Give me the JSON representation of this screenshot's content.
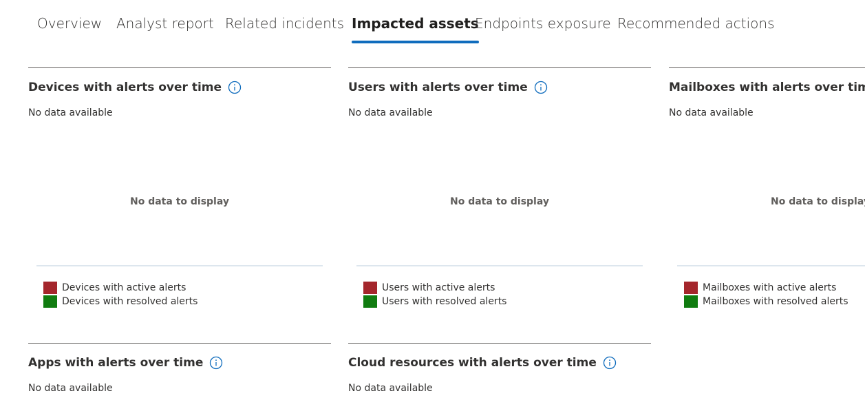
{
  "tabs": [
    {
      "label": "Overview",
      "active": false
    },
    {
      "label": "Analyst report",
      "active": false
    },
    {
      "label": "Related incidents",
      "active": false
    },
    {
      "label": "Impacted assets",
      "active": true
    },
    {
      "label": "Endpoints exposure",
      "active": false
    },
    {
      "label": "Recommended actions",
      "active": false
    }
  ],
  "colors": {
    "accent": "#0f6cbd",
    "active_alerts": "#a4262c",
    "resolved_alerts": "#107c10"
  },
  "cards": [
    {
      "title": "Devices with alerts over time",
      "status": "No data available",
      "placeholder": "No data to display",
      "legend": [
        "Devices with active alerts",
        "Devices with resolved alerts"
      ]
    },
    {
      "title": "Users with alerts over time",
      "status": "No data available",
      "placeholder": "No data to display",
      "legend": [
        "Users with active alerts",
        "Users with resolved alerts"
      ]
    },
    {
      "title": "Mailboxes with alerts over time",
      "status": "No data available",
      "placeholder": "No data to display",
      "legend": [
        "Mailboxes with active alerts",
        "Mailboxes with resolved alerts"
      ]
    },
    {
      "title": "Apps with alerts over time",
      "status": "No data available"
    },
    {
      "title": "Cloud resources with alerts over time",
      "status": "No data available"
    }
  ]
}
